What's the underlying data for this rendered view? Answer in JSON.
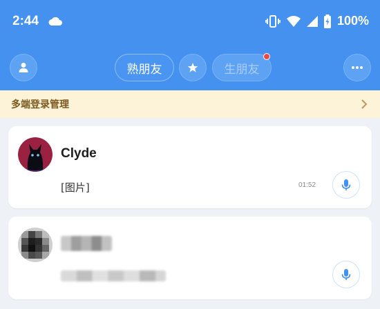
{
  "status_bar": {
    "time": "2:44",
    "battery": "100%",
    "icons": [
      "cloud-icon",
      "vibrate-icon",
      "wifi-icon",
      "signal-icon",
      "battery-icon"
    ]
  },
  "nav": {
    "profile_icon": "person-icon",
    "tab_close_friends": "熟朋友",
    "star_icon": "star-icon",
    "tab_strangers": "生朋友",
    "more_icon": "more-icon"
  },
  "banner": {
    "text": "多端登录管理"
  },
  "conversations": [
    {
      "name": "Clyde",
      "message": "[图片]",
      "time": "01:52"
    },
    {
      "name": "",
      "message": "",
      "time": ""
    }
  ],
  "colors": {
    "header_blue": "#4591f0",
    "banner_bg": "#fdf3d9",
    "banner_text": "#7a5a1e",
    "unread_dot": "#f04a48",
    "mic_blue": "#4591f0"
  }
}
